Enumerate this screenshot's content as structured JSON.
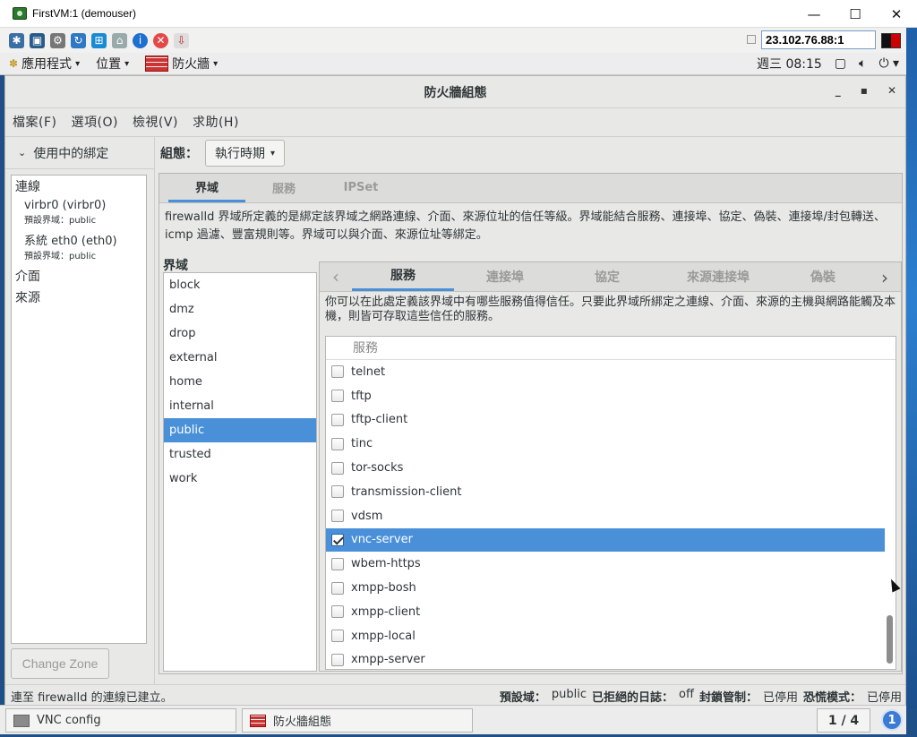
{
  "vnc_window": {
    "title": "FirstVM:1 (demouser)",
    "controls": [
      "—",
      "☐",
      "✕"
    ]
  },
  "vnc_toolbar": {
    "host": "23.102.76.88:1"
  },
  "gnome_top": {
    "menus": [
      "應用程式",
      "位置",
      "防火牆"
    ],
    "clock": "週三 08:15"
  },
  "app": {
    "title": "防火牆組態",
    "menubar": [
      "檔案(F)",
      "選項(O)",
      "檢視(V)",
      "求助(H)"
    ],
    "left": {
      "header": "使用中的綁定",
      "connections_label": "連線",
      "connections": [
        {
          "name": "virbr0 (virbr0)",
          "zone": "預設界域：public"
        },
        {
          "name": "系統  eth0 (eth0)",
          "zone": "預設界域：public"
        }
      ],
      "interfaces_label": "介面",
      "sources_label": "來源",
      "change_zone": "Change Zone"
    },
    "config": {
      "label": "組態：",
      "value": "執行時期"
    },
    "tabs": [
      "界域",
      "服務",
      "IPSet"
    ],
    "zone_description": "firewalld 界域所定義的是綁定該界域之網路連線、介面、來源位址的信任等級。界域能結合服務、連接埠、協定、偽裝、連接埠/封包轉送、icmp 過濾、豐富規則等。界域可以與介面、來源位址等綁定。",
    "zone_label": "界域",
    "zones": [
      "block",
      "dmz",
      "drop",
      "external",
      "home",
      "internal",
      "public",
      "trusted",
      "work"
    ],
    "selected_zone": "public",
    "inner_tabs": [
      "服務",
      "連接埠",
      "協定",
      "來源連接埠",
      "偽裝"
    ],
    "services_description": "你可以在此處定義該界域中有哪些服務值得信任。只要此界域所綁定之連線、介面、來源的主機與網路能觸及本機，則皆可存取這些信任的服務。",
    "services_header": "服務",
    "services": [
      {
        "name": "telnet",
        "checked": false
      },
      {
        "name": "tftp",
        "checked": false
      },
      {
        "name": "tftp-client",
        "checked": false
      },
      {
        "name": "tinc",
        "checked": false
      },
      {
        "name": "tor-socks",
        "checked": false
      },
      {
        "name": "transmission-client",
        "checked": false
      },
      {
        "name": "vdsm",
        "checked": false
      },
      {
        "name": "vnc-server",
        "checked": true
      },
      {
        "name": "wbem-https",
        "checked": false
      },
      {
        "name": "xmpp-bosh",
        "checked": false
      },
      {
        "name": "xmpp-client",
        "checked": false
      },
      {
        "name": "xmpp-local",
        "checked": false
      },
      {
        "name": "xmpp-server",
        "checked": false
      }
    ],
    "selected_service": "vnc-server",
    "status": {
      "left": "連至 firewalld 的連線已建立。",
      "default_zone_label": "預設域：",
      "default_zone": "public",
      "log_denied_label": "已拒絕的日誌：",
      "log_denied": "off",
      "lockdown_label": "封鎖管制：",
      "lockdown": "已停用",
      "panic_label": "恐慌模式：",
      "panic": "已停用"
    }
  },
  "gnome_bottom": {
    "tasks": [
      "VNC config",
      "防火牆組態"
    ],
    "workspace": "1 / 4",
    "notification_count": "1"
  }
}
